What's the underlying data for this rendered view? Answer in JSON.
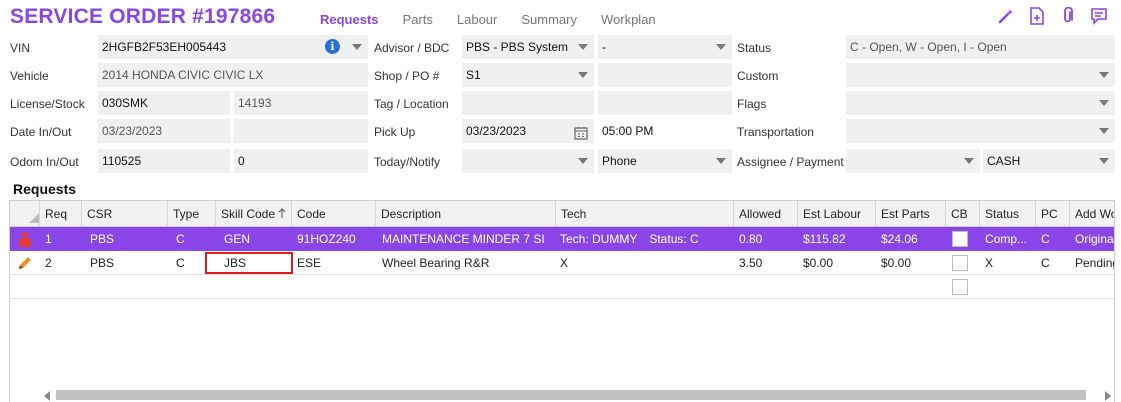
{
  "header": {
    "title": "SERVICE ORDER #197866",
    "tabs": [
      {
        "label": "Requests",
        "active": true
      },
      {
        "label": "Parts",
        "active": false
      },
      {
        "label": "Labour",
        "active": false
      },
      {
        "label": "Summary",
        "active": false
      },
      {
        "label": "Workplan",
        "active": false
      }
    ],
    "icons": [
      "magic-wand-icon",
      "document-add-icon",
      "paperclip-icon",
      "chat-icon"
    ],
    "accent_color": "#8a45e8"
  },
  "form": {
    "vin_label": "VIN",
    "vin_value": "2HGFB2F53EH005443",
    "vehicle_label": "Vehicle",
    "vehicle_value": "2014 HONDA CIVIC CIVIC LX",
    "license_label": "License/Stock",
    "license_value": "030SMK",
    "stock_value": "14193",
    "date_label": "Date In/Out",
    "date_in_value": "03/23/2023",
    "date_out_value": "",
    "odom_label": "Odom In/Out",
    "odom_in_value": "110525",
    "odom_out_value": "0",
    "advisor_label": "Advisor / BDC",
    "advisor_value": "PBS - PBS System",
    "bdc_value": "-",
    "shop_label": "Shop / PO #",
    "shop_value": "S1",
    "po_value": "",
    "tag_label": "Tag / Location",
    "tag_value": "",
    "location_value": "",
    "pickup_label": "Pick Up",
    "pickup_date": "03/23/2023",
    "pickup_time": "05:00 PM",
    "today_label": "Today/Notify",
    "today_value": "",
    "notify_value": "Phone",
    "status_label": "Status",
    "status_value": "C - Open, W - Open, I - Open",
    "custom_label": "Custom",
    "custom_value": "",
    "flags_label": "Flags",
    "flags_value": "",
    "transport_label": "Transportation",
    "transport_value": "",
    "assignee_label": "Assignee / Payment",
    "assignee_value": "",
    "payment_value": "CASH"
  },
  "requests": {
    "title": "Requests",
    "columns": [
      "Req",
      "CSR",
      "Type",
      "Skill Code",
      "Code",
      "Description",
      "Tech",
      "Allowed",
      "Est Labour",
      "Est Parts",
      "CB",
      "Status",
      "PC",
      "Add Wo"
    ],
    "sort_column": "Skill Code",
    "rows": [
      {
        "req": "1",
        "csr": "PBS",
        "type": "C",
        "skill": "GEN",
        "code": "91HOZ240",
        "desc": "MAINTENANCE MINDER 7 SI",
        "tech": "Tech: DUMMY",
        "tech_status": "Status: C",
        "allowed": "0.80",
        "labour": "$115.82",
        "parts": "$24.06",
        "status": "Comp...",
        "pc": "C",
        "add": "Origina",
        "selected": true,
        "row_icon": "person-icon"
      },
      {
        "req": "2",
        "csr": "PBS",
        "type": "C",
        "skill": "JBS",
        "code": "ESE",
        "desc": "Wheel Bearing R&R",
        "tech": "X",
        "tech_status": "",
        "allowed": "3.50",
        "labour": "$0.00",
        "parts": "$0.00",
        "status": "X",
        "pc": "C",
        "add": "Pending",
        "selected": false,
        "row_icon": "pencil-icon"
      }
    ]
  }
}
